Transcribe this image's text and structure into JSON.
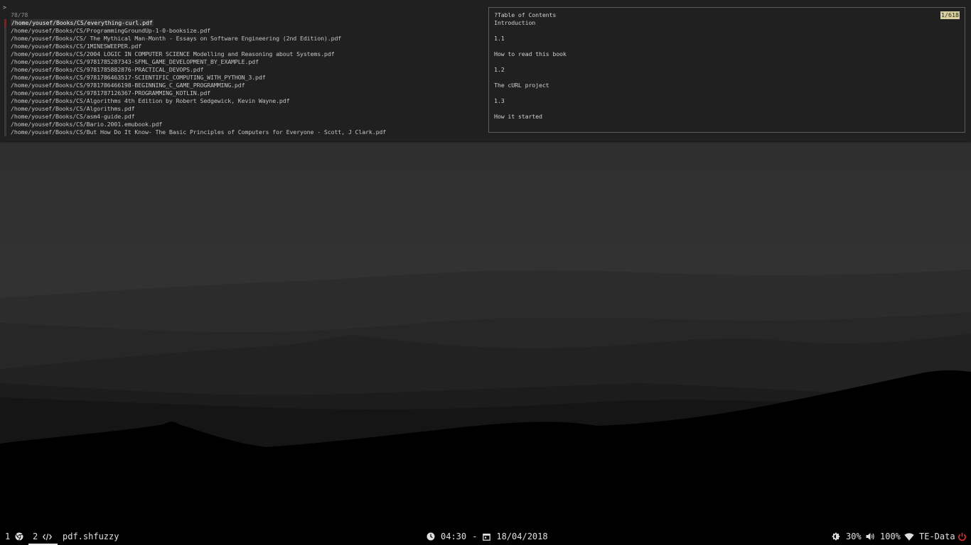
{
  "fzf": {
    "prompt": ">",
    "match_count": "78/78",
    "results": [
      "/home/yousef/Books/CS/everything-curl.pdf",
      "/home/yousef/Books/CS/ProgrammingGroundUp-1-0-booksize.pdf",
      "/home/yousef/Books/CS/ The Mythical Man-Month - Essays on Software Engineering (2nd Edition).pdf",
      "/home/yousef/Books/CS/1MINESWEEPER.pdf",
      "/home/yousef/Books/CS/2004 LOGIC IN COMPUTER SCIENCE Modelling and Reasoning about Systems.pdf",
      "/home/yousef/Books/CS/9781785287343-SFML_GAME_DEVELOPMENT_BY_EXAMPLE.pdf",
      "/home/yousef/Books/CS/9781785882876-PRACTICAL_DEVOPS.pdf",
      "/home/yousef/Books/CS/9781786463517-SCIENTIFIC_COMPUTING_WITH_PYTHON_3.pdf",
      "/home/yousef/Books/CS/9781786466198-BEGINNING_C_GAME_PROGRAMMING.pdf",
      "/home/yousef/Books/CS/9781787126367-PROGRAMMING_KOTLIN.pdf",
      "/home/yousef/Books/CS/Algorithms 4th Edition by Robert Sedgewick, Kevin Wayne.pdf",
      "/home/yousef/Books/CS/Algorithms.pdf",
      "/home/yousef/Books/CS/asm4-guide.pdf",
      "/home/yousef/Books/CS/Bario.2001.emubook.pdf",
      "/home/yousef/Books/CS/But How Do It Know- The Basic Principles of Computers for Everyone - Scott, J Clark.pdf"
    ],
    "selected_index": 0,
    "preview": {
      "position": "1/618",
      "lines": [
        "?Table of Contents",
        "Introduction",
        "",
        "1.1",
        "",
        "How to read this book",
        "",
        "1.2",
        "",
        "The cURL project",
        "",
        "1.3",
        "",
        "How it started"
      ]
    }
  },
  "bar": {
    "workspaces": [
      {
        "number": "1",
        "icon": "chrome-icon",
        "active": false
      },
      {
        "number": "2",
        "icon": "code-icon",
        "active": true
      }
    ],
    "window_title": "pdf.shfuzzy",
    "clock": {
      "icon": "clock-icon",
      "time": "04:30",
      "separator": "-",
      "date_icon": "calendar-icon",
      "date": "18/04/2018"
    },
    "brightness": {
      "icon": "brightness-icon",
      "value": "30%"
    },
    "volume": {
      "icon": "volume-icon",
      "value": "100%"
    },
    "network": {
      "icon": "wifi-icon",
      "ssid": "TE-Data"
    },
    "power": {
      "icon": "power-icon",
      "color": "#e03030"
    }
  },
  "wallpaper": {
    "sky_color": "#2e2e2e",
    "ground_color": "#000000"
  }
}
